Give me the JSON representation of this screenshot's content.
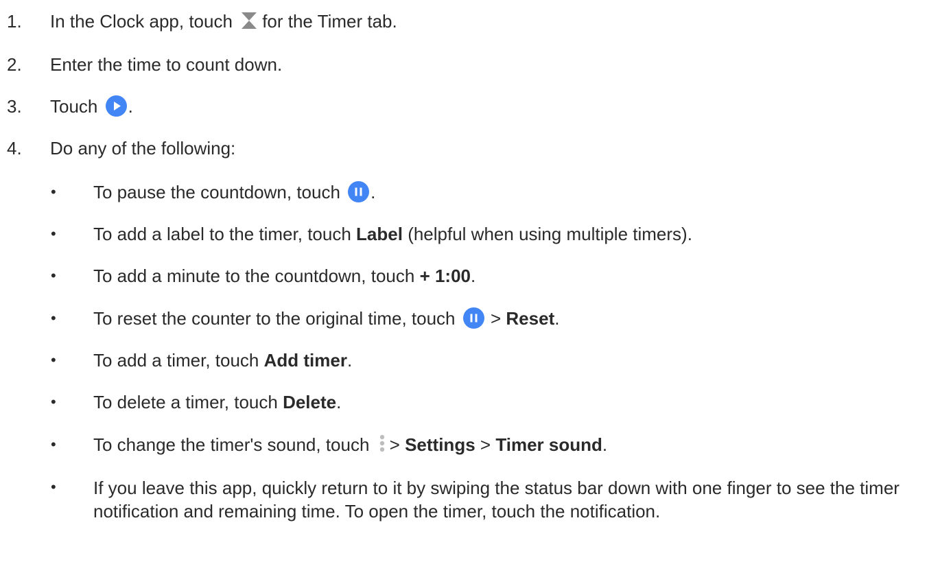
{
  "steps": [
    {
      "num": "1.",
      "pre": "In the Clock app, touch",
      "icon": "hourglass-icon",
      "post": "for the Timer tab."
    },
    {
      "num": "2.",
      "text": "Enter the time to count down."
    },
    {
      "num": "3.",
      "pre": "Touch",
      "icon": "play-icon",
      "post": "."
    },
    {
      "num": "4.",
      "text": "Do any of the following:"
    }
  ],
  "bullets": {
    "symbol": "•",
    "pause": {
      "pre": "To pause the countdown, touch",
      "icon": "pause-icon",
      "post": "."
    },
    "label": {
      "pre": "To add a label to the timer, touch",
      "bold": "Label",
      "post": "(helpful when using multiple timers)."
    },
    "minute": {
      "pre": "To add a minute to the countdown, touch",
      "bold": "+ 1:00",
      "post": "."
    },
    "reset": {
      "pre": "To reset the counter to the original time, touch",
      "icon": "pause-icon",
      "sep": ">",
      "bold": "Reset",
      "post": "."
    },
    "add": {
      "pre": "To add a timer, touch",
      "bold": "Add timer",
      "post": "."
    },
    "delete": {
      "pre": "To delete a timer, touch",
      "bold": "Delete",
      "post": "."
    },
    "sound": {
      "pre": "To change the timer's sound, touch",
      "icon": "more-vert-icon",
      "sep1": ">",
      "bold1": "Settings",
      "sep2": ">",
      "bold2": "Timer sound",
      "post": "."
    },
    "leave": {
      "text": "If you leave this app, quickly return to it by swiping the status bar down with one finger to see the timer notification and remaining time. To open the timer, touch the notification."
    }
  },
  "colors": {
    "accent": "#4285f4",
    "text": "#2a2a2a",
    "icon_gray": "#8a8a8a"
  }
}
